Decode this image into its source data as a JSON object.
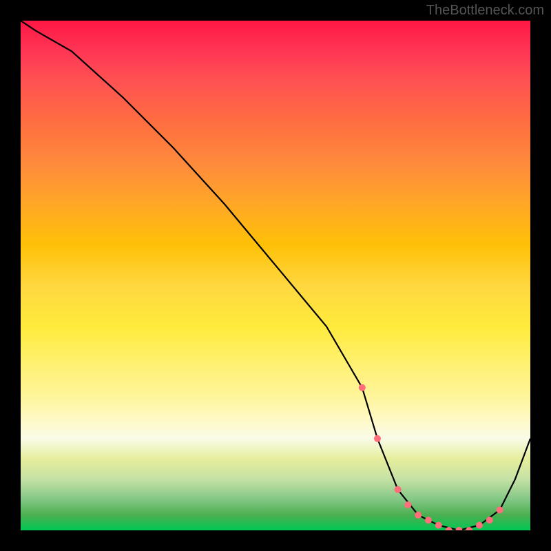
{
  "attribution": "TheBottleneck.com",
  "chart_data": {
    "type": "line",
    "title": "",
    "xlabel": "",
    "ylabel": "",
    "xlim": [
      0,
      100
    ],
    "ylim": [
      0,
      100
    ],
    "grid": false,
    "legend": false,
    "series": [
      {
        "name": "bottleneck-curve",
        "x": [
          0,
          3,
          10,
          20,
          30,
          40,
          50,
          60,
          67,
          70,
          74,
          78,
          82,
          86,
          90,
          94,
          97,
          100
        ],
        "values": [
          100,
          98,
          94,
          85,
          75,
          64,
          52,
          40,
          28,
          18,
          8,
          3,
          1,
          0,
          1,
          4,
          10,
          18
        ]
      }
    ],
    "markers": {
      "name": "highlight-points",
      "x": [
        67,
        70,
        74,
        76,
        78,
        80,
        82,
        84,
        86,
        88,
        90,
        92,
        94
      ],
      "values": [
        28,
        18,
        8,
        5,
        3,
        2,
        1,
        0,
        0,
        0,
        1,
        2,
        4
      ],
      "color": "#ff6e7a"
    },
    "background_gradient": {
      "top_color": "#ff1744",
      "bottom_color": "#00c853",
      "description": "red (high bottleneck) to green (low bottleneck)"
    }
  }
}
